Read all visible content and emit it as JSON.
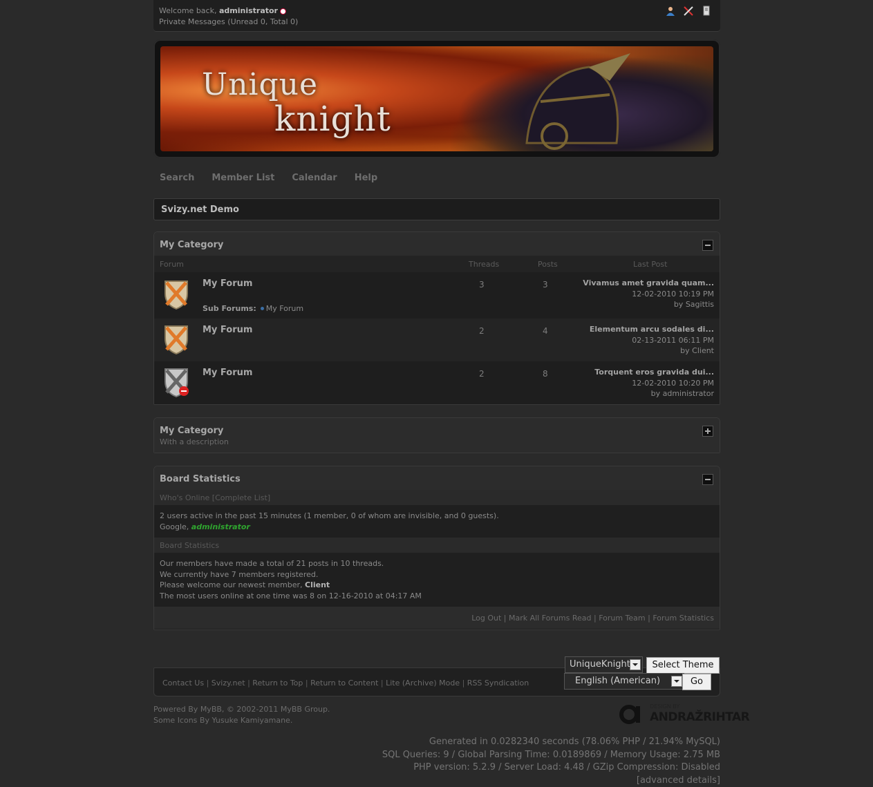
{
  "userbar": {
    "welcome_prefix": "Welcome back, ",
    "username": "administrator",
    "pm_text": "Private Messages (Unread 0, Total 0)",
    "icons": [
      "user-cp-icon",
      "admin-cp-icon",
      "logout-icon"
    ]
  },
  "banner": {
    "logo_line1": "Unique",
    "logo_line2": "knight"
  },
  "nav": {
    "search": "Search",
    "member_list": "Member List",
    "calendar": "Calendar",
    "help": "Help"
  },
  "breadcrumb": "Svizy.net Demo",
  "category1": {
    "title": "My Category",
    "columns": {
      "forum": "Forum",
      "threads": "Threads",
      "posts": "Posts",
      "last_post": "Last Post"
    },
    "forums": [
      {
        "name": "My Forum",
        "threads": "3",
        "posts": "3",
        "last_title": "Vivamus amet gravida quam...",
        "last_date": "12-02-2010 10:19 PM",
        "last_by": "by Sagittis",
        "sub_label": "Sub Forums:",
        "sub_forum": "My Forum",
        "icon": "forum-on-icon"
      },
      {
        "name": "My Forum",
        "threads": "2",
        "posts": "4",
        "last_title": "Elementum arcu sodales di...",
        "last_date": "02-13-2011 06:11 PM",
        "last_by": "by Client",
        "icon": "forum-on-icon"
      },
      {
        "name": "My Forum",
        "threads": "2",
        "posts": "8",
        "last_title": "Torquent eros gravida dui...",
        "last_date": "12-02-2010 10:20 PM",
        "last_by": "by administrator",
        "icon": "forum-locked-icon"
      }
    ]
  },
  "category2": {
    "title": "My Category",
    "description": "With a description"
  },
  "stats": {
    "title": "Board Statistics",
    "whos_online_label": "Who's Online [Complete List]",
    "online_line1": "2 users active in the past 15 minutes (1 member, 0 of whom are invisible, and 0 guests).",
    "online_line2_prefix": "Google, ",
    "online_member": "administrator",
    "stats_label": "Board Statistics",
    "stats_line1": "Our members have made a total of 21 posts in 10 threads.",
    "stats_line2": "We currently have 7 members registered.",
    "stats_line3_prefix": "Please welcome our newest member, ",
    "newest_member": "Client",
    "stats_line4": "The most users online at one time was 8 on 12-16-2010 at 04:17 AM",
    "footer_links": [
      "Log Out",
      "Mark All Forums Read",
      "Forum Team",
      "Forum Statistics"
    ]
  },
  "bottom": {
    "links": [
      "Contact Us",
      "Svizy.net",
      "Return to Top",
      "Return to Content",
      "Lite (Archive) Mode",
      "RSS Syndication"
    ],
    "theme_value": "UniqueKnight",
    "theme_button": "Select Theme",
    "lang_value": "English (American)",
    "lang_button": "Go"
  },
  "powered": {
    "line1": "Powered By MyBB, © 2002-2011 MyBB Group.",
    "line2": "Some Icons By Yusuke Kamiyamane."
  },
  "designby": {
    "small": "DESIGN BY",
    "name": "ANDRAŽRIHTAR"
  },
  "debug": {
    "line1": "Generated in 0.0282340 seconds (78.06% PHP / 21.94% MySQL)",
    "line2": "SQL Queries: 9 / Global Parsing Time: 0.0189869 / Memory Usage: 2.75 MB",
    "line3": "PHP version: 5.2.9 / Server Load: 4.48 / GZip Compression: Disabled",
    "line4": "[advanced details]"
  }
}
